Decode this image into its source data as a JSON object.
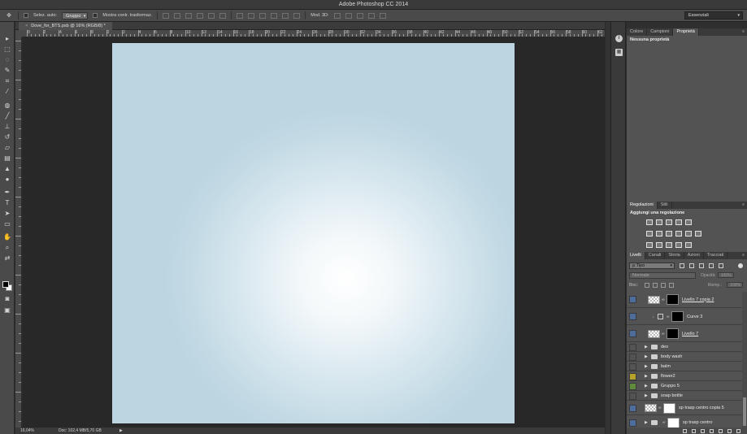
{
  "app": {
    "title": "Adobe Photoshop CC 2014"
  },
  "options_bar": {
    "auto_select_label": "Selez. auto:",
    "auto_select_value": "Gruppo",
    "transform_label": "Mostra contr. trasformaz.",
    "mode_3d_label": "Mod. 3D:",
    "workspace": "Essenziali"
  },
  "document": {
    "tab_label": "Dove_for_BTS.psb @ 16% (RGB/8) *",
    "close_glyph": "×",
    "ruler_labels": [
      "0",
      "2",
      "4",
      "6",
      "8",
      "0",
      "2",
      "4",
      "6",
      "8",
      "10",
      "12",
      "14",
      "16",
      "18",
      "20",
      "22",
      "24",
      "26",
      "28",
      "30",
      "32",
      "34",
      "36",
      "38",
      "40",
      "42",
      "44",
      "46",
      "48",
      "50",
      "52",
      "54",
      "56",
      "58",
      "60",
      "62"
    ],
    "canvas_gradient": {
      "center": "#ffffff",
      "edge": "#bcd5e1"
    }
  },
  "status_bar": {
    "zoom": "16,04%",
    "doc_info": "Doc: 102,4 MB/5,70 GB",
    "arrow": "▶"
  },
  "tools": [
    "move-tool",
    "marquee-tool",
    "lasso-tool",
    "quick-select-tool",
    "crop-tool",
    "eyedropper-tool",
    "spot-heal-tool",
    "brush-tool",
    "clone-stamp-tool",
    "history-brush-tool",
    "eraser-tool",
    "gradient-tool",
    "blur-tool",
    "dodge-tool",
    "pen-tool",
    "type-tool",
    "path-select-tool",
    "rectangle-tool",
    "hand-tool",
    "zoom-tool"
  ],
  "colors": {
    "foreground": "#000000",
    "background": "#ffffff",
    "layer_blue": "#4d6d9e",
    "layer_yellow": "#b7a32b",
    "layer_green": "#5e8c3c"
  },
  "properties_panel": {
    "tabs": [
      "Colore",
      "Campioni",
      "Proprietà"
    ],
    "active_tab": "Proprietà",
    "message": "Nessuna proprietà"
  },
  "adjustments_panel": {
    "tabs": [
      "Regolazioni",
      "Stili"
    ],
    "title": "Aggiungi una regolazione"
  },
  "layers_panel": {
    "tabs": [
      "Livelli",
      "Canali",
      "Storia",
      "Azioni",
      "Tracciati"
    ],
    "filter": "ρ Tipo",
    "blend_mode": "Normale",
    "opacity_label": "Opacità:",
    "opacity_value": "100%",
    "lock_label": "Bloc:",
    "fill_label": "Riemp.:",
    "fill_value": "100%",
    "layers": [
      {
        "name": "Livello 7 copia 2",
        "vis": "blue",
        "kind": "masked",
        "underline": true
      },
      {
        "name": "Curve 3",
        "vis": "blue",
        "kind": "adjustment",
        "underline": false
      },
      {
        "name": "Livello 7",
        "vis": "blue",
        "kind": "masked",
        "underline": true
      },
      {
        "name": "deo",
        "vis": "none",
        "kind": "group"
      },
      {
        "name": "body wash",
        "vis": "none",
        "kind": "group"
      },
      {
        "name": "balm",
        "vis": "none",
        "kind": "group"
      },
      {
        "name": "flower2",
        "vis": "yellow",
        "kind": "group"
      },
      {
        "name": "Gruppo 5",
        "vis": "green",
        "kind": "group"
      },
      {
        "name": "soap bottle",
        "vis": "none",
        "kind": "group"
      },
      {
        "name": "sp trasp centro copia 5",
        "vis": "blue",
        "kind": "smart"
      },
      {
        "name": "sp trasp centro",
        "vis": "blue",
        "kind": "group-mask"
      }
    ]
  }
}
